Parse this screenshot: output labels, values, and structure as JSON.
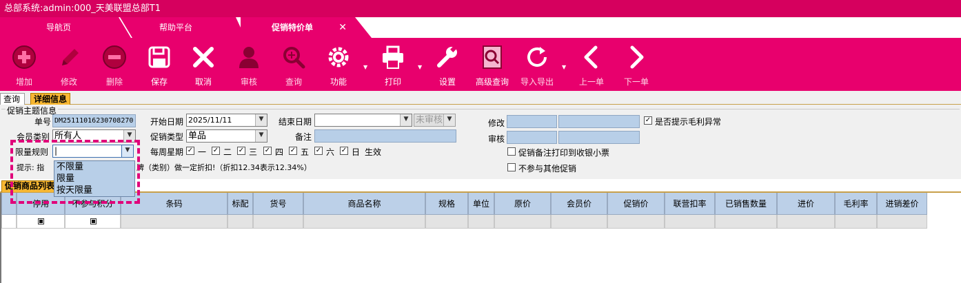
{
  "window": {
    "title": "总部系统:admin:000_天美联盟总部T1"
  },
  "tabs": [
    {
      "label": "导航页"
    },
    {
      "label": "帮助平台"
    },
    {
      "label": "促销特价单",
      "close": "✕"
    }
  ],
  "toolbar": [
    {
      "label": "增加",
      "icon": "add-icon"
    },
    {
      "label": "修改",
      "icon": "pencil-icon"
    },
    {
      "label": "删除",
      "icon": "minus-icon"
    },
    {
      "label": "保存",
      "icon": "save-icon"
    },
    {
      "label": "取消",
      "icon": "close-icon"
    },
    {
      "label": "审核",
      "icon": "person-icon"
    },
    {
      "label": "查询",
      "icon": "search-icon"
    },
    {
      "label": "功能",
      "icon": "gear-icon"
    },
    {
      "label": "打印",
      "icon": "printer-icon"
    },
    {
      "label": "设置",
      "icon": "wrench-icon"
    },
    {
      "label": "高级查询",
      "icon": "advanced-search-icon"
    },
    {
      "label": "导入导出",
      "icon": "refresh-icon"
    },
    {
      "label": "上一单",
      "icon": "chevron-left-icon"
    },
    {
      "label": "下一单",
      "icon": "chevron-right-icon"
    }
  ],
  "subtabs": [
    {
      "label": "查询"
    },
    {
      "label": "详细信息"
    }
  ],
  "form": {
    "group_title": "促销主题信息",
    "order_no_label": "单号",
    "order_no": "DM25111016230708270",
    "start_date_label": "开始日期",
    "start_date": "2025/11/11",
    "end_date_label": "结束日期",
    "end_date": "  /  /",
    "status": "未审核",
    "modify_label": "修改",
    "audit_label": "审核",
    "margin_alert_label": "是否提示毛利异常",
    "member_type_label": "会员类别",
    "member_type": "所有人",
    "promo_type_label": "促销类型",
    "promo_type": "单品",
    "remark_label": "备注",
    "limit_rule_label": "限量规则",
    "limit_rule": "|",
    "weekday_label": "每周星期",
    "weekdays": [
      "一",
      "二",
      "三",
      "四",
      "五",
      "六",
      "日"
    ],
    "effective_label": "生效",
    "print_remark_label": "促销备注打印到收银小票",
    "no_other_promo_label": "不参与其他促销",
    "hint_prefix": "提示: 指",
    "hint_suffix": "牌（类别）做一定折扣!（折扣12.34表示12.34%）",
    "limit_options": [
      "不限量",
      "限量",
      "按天限量"
    ]
  },
  "grid": {
    "tab_label": "促销商品列表",
    "columns": [
      "停用",
      "不参与积分",
      "条码",
      "标配",
      "货号",
      "商品名称",
      "规格",
      "单位",
      "原价",
      "会员价",
      "促销价",
      "联营扣率",
      "已销售数量",
      "进价",
      "毛利率",
      "进销差价"
    ]
  }
}
